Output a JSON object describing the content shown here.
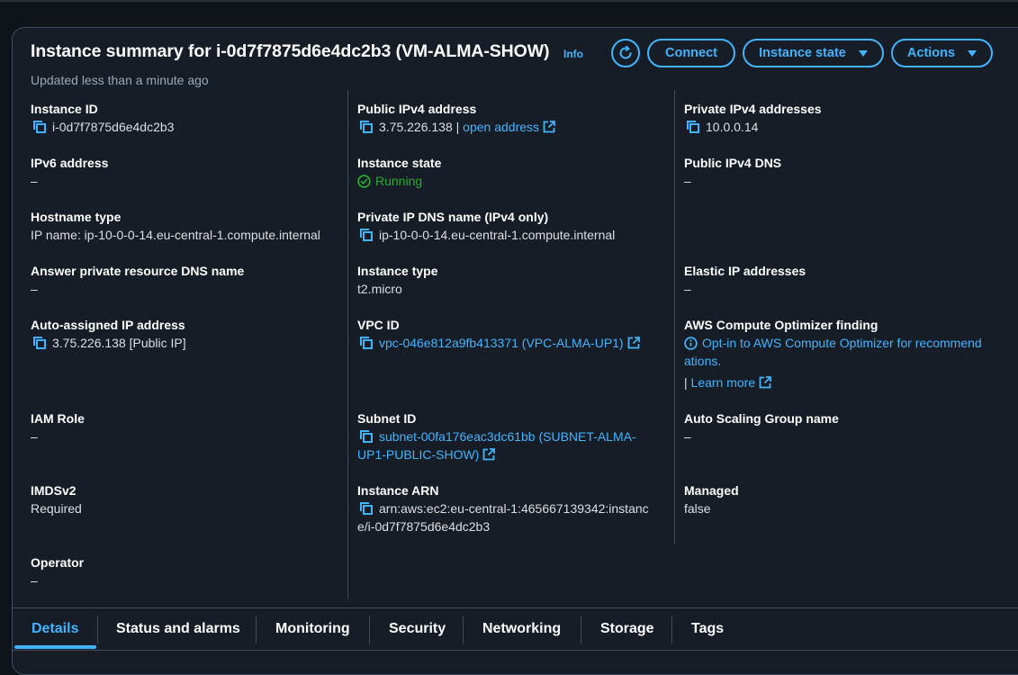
{
  "header": {
    "title": "Instance summary for i-0d7f7875d6e4dc2b3 (VM-ALMA-SHOW)",
    "info": "Info",
    "updated": "Updated less than a minute ago"
  },
  "buttons": {
    "connect": "Connect",
    "instance_state": "Instance state",
    "actions": "Actions"
  },
  "colors": {
    "accent": "#42b4ff",
    "success": "#29ad32",
    "background": "#0f141a",
    "panel": "#161d26"
  },
  "col1": {
    "instance_id_label": "Instance ID",
    "instance_id": "i-0d7f7875d6e4dc2b3",
    "ipv6_label": "IPv6 address",
    "ipv6": "–",
    "hostname_type_label": "Hostname type",
    "hostname_type": "IP name: ip-10-0-0-14.eu-central-1.compute.internal",
    "answer_dns_label": "Answer private resource DNS name",
    "answer_dns": "–",
    "auto_ip_label": "Auto-assigned IP address",
    "auto_ip": "3.75.226.138 [Public IP]",
    "iam_role_label": "IAM Role",
    "iam_role": "–",
    "imdsv2_label": "IMDSv2",
    "imdsv2": "Required",
    "operator_label": "Operator",
    "operator": "–"
  },
  "col2": {
    "public_ipv4_label": "Public IPv4 address",
    "public_ipv4": "3.75.226.138",
    "separator": " | ",
    "open_address": "open address",
    "instance_state_label": "Instance state",
    "instance_state": "Running",
    "private_dns_label": "Private IP DNS name (IPv4 only)",
    "private_dns": "ip-10-0-0-14.eu-central-1.compute.internal",
    "instance_type_label": "Instance type",
    "instance_type": "t2.micro",
    "vpc_label": "VPC ID",
    "vpc": "vpc-046e812a9fb413371 (VPC-ALMA-UP1)",
    "subnet_label": "Subnet ID",
    "subnet_line1": "subnet-00fa176eac3dc61bb (SUBNET-ALMA-",
    "subnet_line2": "UP1-PUBLIC-SHOW)",
    "arn_label": "Instance ARN",
    "arn_line1": "arn:aws:ec2:eu-central-1:465667139342:instanc",
    "arn_line2": "e/i-0d7f7875d6e4dc2b3"
  },
  "col3": {
    "private_ipv4_label": "Private IPv4 addresses",
    "private_ipv4": "10.0.0.14",
    "public_dns_label": "Public IPv4 DNS",
    "public_dns": "–",
    "elastic_ip_label": "Elastic IP addresses",
    "elastic_ip": "–",
    "optimizer_label": "AWS Compute Optimizer finding",
    "optimizer_line1": "Opt-in to AWS Compute Optimizer for recommend",
    "optimizer_line2": "ations.",
    "learn_sep": "| ",
    "learn_more": "Learn more",
    "asg_label": "Auto Scaling Group name",
    "asg": "–",
    "managed_label": "Managed",
    "managed": "false"
  },
  "tabs": [
    "Details",
    "Status and alarms",
    "Monitoring",
    "Security",
    "Networking",
    "Storage",
    "Tags"
  ]
}
